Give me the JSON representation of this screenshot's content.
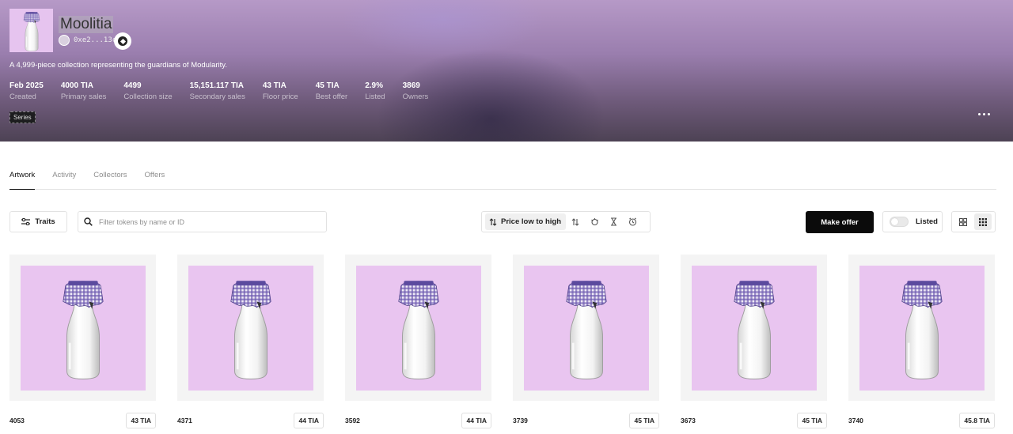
{
  "collection": {
    "title": "Moolitia",
    "creator_address": "0xe2...13cc",
    "description": "A 4,999-piece collection representing the guardians of Modularity.",
    "series_tag": "Series",
    "stats": [
      {
        "value": "Feb 2025",
        "label": "Created"
      },
      {
        "value": "4000 TIA",
        "label": "Primary sales"
      },
      {
        "value": "4499",
        "label": "Collection size"
      },
      {
        "value": "15,151.117 TIA",
        "label": "Secondary sales"
      },
      {
        "value": "43 TIA",
        "label": "Floor price"
      },
      {
        "value": "45 TIA",
        "label": "Best offer"
      },
      {
        "value": "2.9%",
        "label": "Listed"
      },
      {
        "value": "3869",
        "label": "Owners"
      }
    ]
  },
  "tabs": [
    "Artwork",
    "Activity",
    "Collectors",
    "Offers"
  ],
  "toolbar": {
    "traits_label": "Traits",
    "search_placeholder": "Filter tokens by name or ID",
    "sort_label": "Price low to high",
    "make_offer_label": "Make offer",
    "listed_label": "Listed"
  },
  "tokens": [
    {
      "id": "4053",
      "price": "43 TIA"
    },
    {
      "id": "4371",
      "price": "44 TIA"
    },
    {
      "id": "3592",
      "price": "44 TIA"
    },
    {
      "id": "3739",
      "price": "45 TIA"
    },
    {
      "id": "3673",
      "price": "45 TIA"
    },
    {
      "id": "3740",
      "price": "45.8 TIA"
    }
  ],
  "colors": {
    "art_background": "#e9c5f0",
    "primary_button": "#0b0b0b",
    "cap_pattern": "#5b4a9e"
  }
}
